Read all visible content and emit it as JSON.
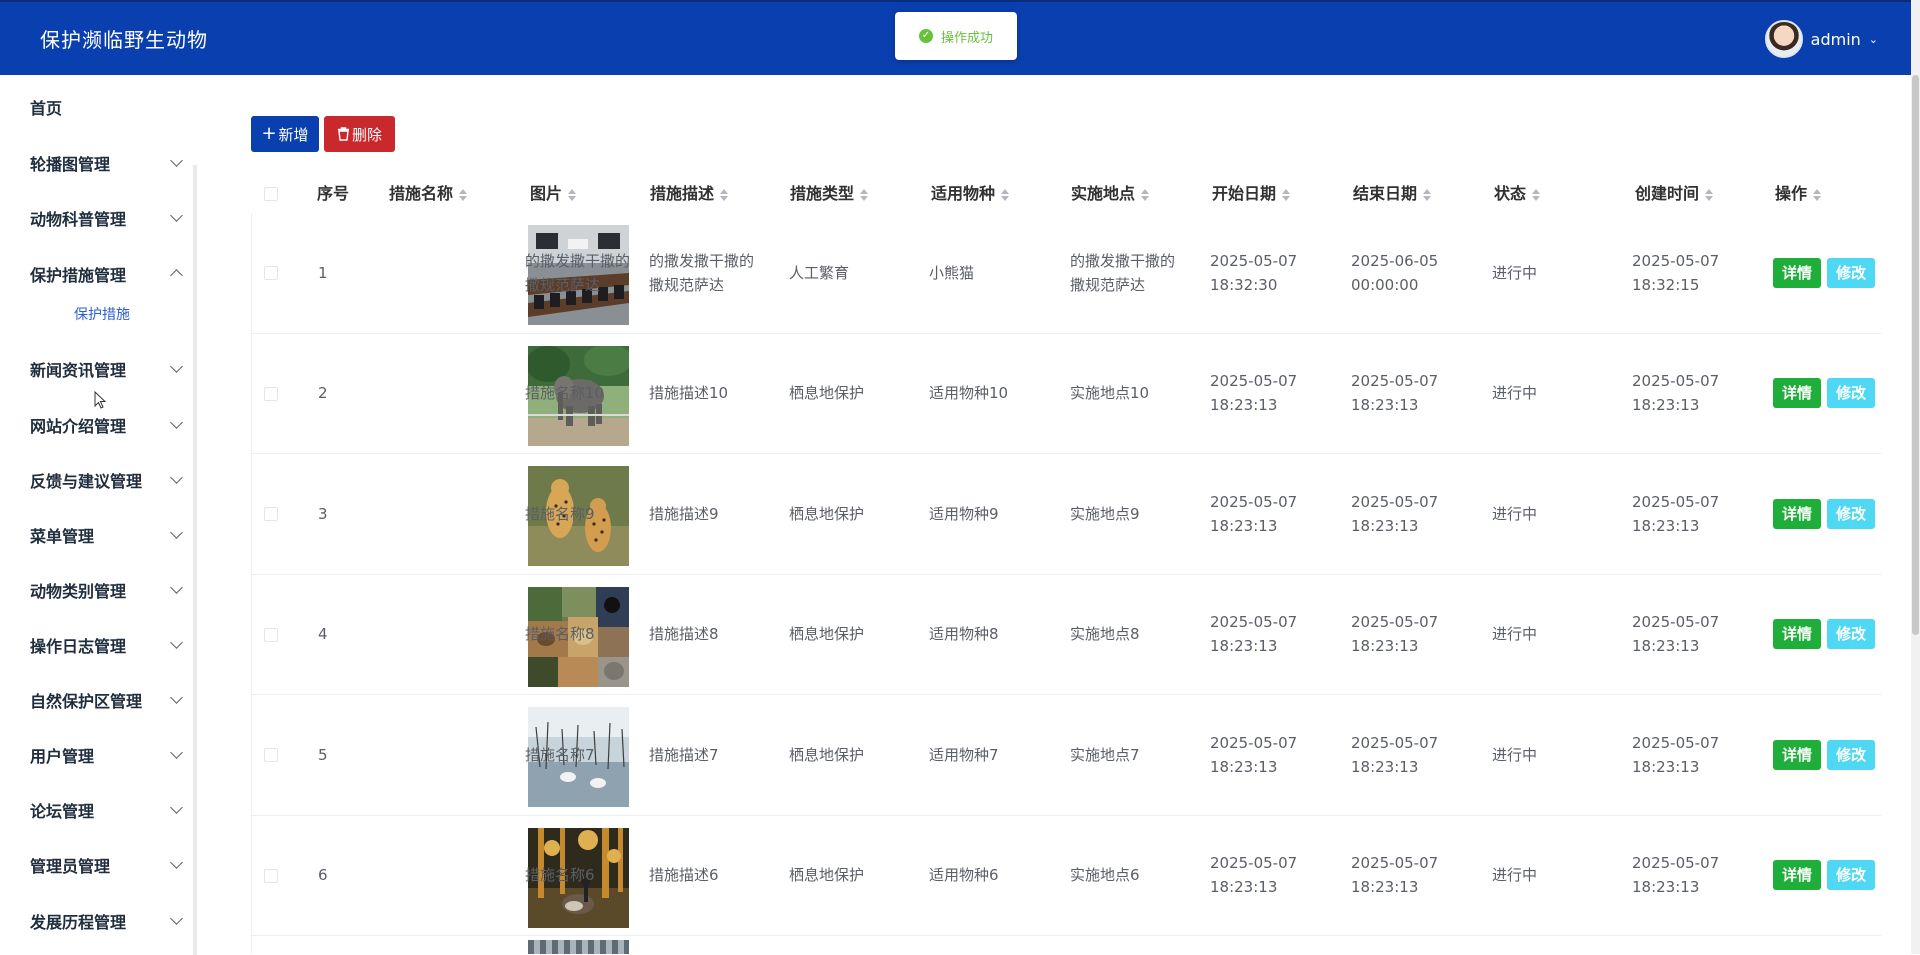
{
  "header": {
    "brand": "保护濒临野生动物",
    "toast": "操作成功",
    "user": "admin"
  },
  "sidebar": {
    "items": [
      {
        "label": "首页",
        "expandable": false
      },
      {
        "label": "轮播图管理",
        "expandable": true
      },
      {
        "label": "动物科普管理",
        "expandable": true
      },
      {
        "label": "保护措施管理",
        "expandable": true,
        "expanded": true
      },
      {
        "label": "新闻资讯管理",
        "expandable": true
      },
      {
        "label": "网站介绍管理",
        "expandable": true
      },
      {
        "label": "反馈与建议管理",
        "expandable": true
      },
      {
        "label": "菜单管理",
        "expandable": true
      },
      {
        "label": "动物类别管理",
        "expandable": true
      },
      {
        "label": "操作日志管理",
        "expandable": true
      },
      {
        "label": "自然保护区管理",
        "expandable": true
      },
      {
        "label": "用户管理",
        "expandable": true
      },
      {
        "label": "论坛管理",
        "expandable": true
      },
      {
        "label": "管理员管理",
        "expandable": true
      },
      {
        "label": "发展历程管理",
        "expandable": true
      }
    ],
    "submenu": {
      "label": "保护措施",
      "active": true
    }
  },
  "toolbar": {
    "add_label": "新增",
    "delete_label": "删除"
  },
  "table": {
    "columns": [
      "序号",
      "措施名称",
      "图片",
      "措施描述",
      "措施类型",
      "适用物种",
      "实施地点",
      "开始日期",
      "结束日期",
      "状态",
      "创建时间",
      "操作"
    ],
    "rows": [
      {
        "no": "1",
        "name": "的撒发撒干撒的撒规范萨达",
        "image": "conference-room",
        "desc": "的撒发撒干撒的撒规范萨达",
        "type": "人工繁育",
        "species": "小熊猫",
        "place": "的撒发撒干撒的撒规范萨达",
        "start": "2025-05-07 18:32:30",
        "end": "2025-06-05 00:00:00",
        "status": "进行中",
        "created": "2025-05-07 18:32:15"
      },
      {
        "no": "2",
        "name": "措施名称10",
        "image": "elephant",
        "desc": "措施描述10",
        "type": "栖息地保护",
        "species": "适用物种10",
        "place": "实施地点10",
        "start": "2025-05-07 18:23:13",
        "end": "2025-05-07 18:23:13",
        "status": "进行中",
        "created": "2025-05-07 18:23:13"
      },
      {
        "no": "3",
        "name": "措施名称9",
        "image": "cheetahs",
        "desc": "措施描述9",
        "type": "栖息地保护",
        "species": "适用物种9",
        "place": "实施地点9",
        "start": "2025-05-07 18:23:13",
        "end": "2025-05-07 18:23:13",
        "status": "进行中",
        "created": "2025-05-07 18:23:13"
      },
      {
        "no": "4",
        "name": "措施名称8",
        "image": "animal-collage",
        "desc": "措施描述8",
        "type": "栖息地保护",
        "species": "适用物种8",
        "place": "实施地点8",
        "start": "2025-05-07 18:23:13",
        "end": "2025-05-07 18:23:13",
        "status": "进行中",
        "created": "2025-05-07 18:23:13"
      },
      {
        "no": "5",
        "name": "措施名称7",
        "image": "wetland-birds",
        "desc": "措施描述7",
        "type": "栖息地保护",
        "species": "适用物种7",
        "place": "实施地点7",
        "start": "2025-05-07 18:23:13",
        "end": "2025-05-07 18:23:13",
        "status": "进行中",
        "created": "2025-05-07 18:23:13"
      },
      {
        "no": "6",
        "name": "措施名称6",
        "image": "goose-forest",
        "desc": "措施描述6",
        "type": "栖息地保护",
        "species": "适用物种6",
        "place": "实施地点6",
        "start": "2025-05-07 18:23:13",
        "end": "2025-05-07 18:23:13",
        "status": "进行中",
        "created": "2025-05-07 18:23:13"
      }
    ],
    "actions": {
      "detail": "详情",
      "edit": "修改"
    }
  },
  "colors": {
    "header_bg": "#0a3fb0",
    "add_btn": "#0a3fb0",
    "delete_btn": "#c9282d",
    "detail_btn": "#1fae3a",
    "edit_btn": "#4fd8f3",
    "submenu_active": "#2a5fd1",
    "toast_success": "#67c23a"
  }
}
